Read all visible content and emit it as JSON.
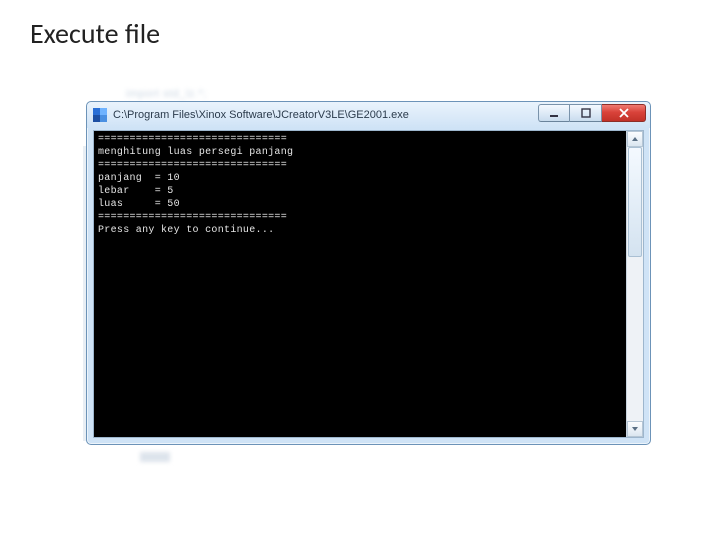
{
  "slide": {
    "title": "Execute file"
  },
  "ghost": {
    "l1": "import   std_lz.*;",
    "l2": "",
    "l3": ""
  },
  "window": {
    "title_path": "C:\\Program Files\\Xinox Software\\JCreatorV3LE\\GE2001.exe",
    "console_lines": [
      "==============================",
      "menghitung luas persegi panjang",
      "==============================",
      "panjang  = 10",
      "lebar    = 5",
      "luas     = 50",
      "==============================",
      "Press any key to continue..."
    ]
  }
}
